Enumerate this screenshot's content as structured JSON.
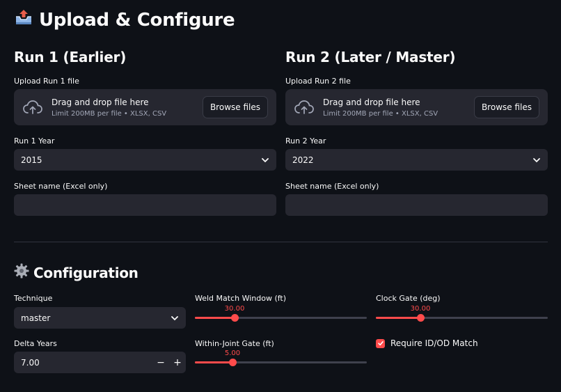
{
  "page": {
    "title": "Upload & Configure",
    "title_icon": "inbox-tray-icon"
  },
  "run1": {
    "heading": "Run 1 (Earlier)",
    "upload_label": "Upload Run 1 file",
    "drop_text": "Drag and drop file here",
    "drop_limit": "Limit 200MB per file • XLSX, CSV",
    "browse_label": "Browse files",
    "year_label": "Run 1 Year",
    "year_value": "2015",
    "sheet_label": "Sheet name (Excel only)",
    "sheet_value": ""
  },
  "run2": {
    "heading": "Run 2 (Later / Master)",
    "upload_label": "Upload Run 2 file",
    "drop_text": "Drag and drop file here",
    "drop_limit": "Limit 200MB per file • XLSX, CSV",
    "browse_label": "Browse files",
    "year_label": "Run 2 Year",
    "year_value": "2022",
    "sheet_label": "Sheet name (Excel only)",
    "sheet_value": ""
  },
  "config": {
    "heading": "Configuration",
    "heading_icon": "gear-icon",
    "technique_label": "Technique",
    "technique_value": "master",
    "delta_label": "Delta Years",
    "delta_value": "7.00",
    "minus": "−",
    "plus": "+",
    "weld_label": "Weld Match Window (ft)",
    "weld_value": "30.00",
    "weld_fraction": 0.23,
    "joint_label": "Within-Joint Gate (ft)",
    "joint_value": "5.00",
    "joint_fraction": 0.22,
    "clock_label": "Clock Gate (deg)",
    "clock_value": "30.00",
    "clock_fraction": 0.26,
    "require_label": "Require ID/OD Match",
    "require_checked": true
  },
  "colors": {
    "accent": "#ff4b4b",
    "background": "#0e1117",
    "input_bg": "#262730"
  }
}
